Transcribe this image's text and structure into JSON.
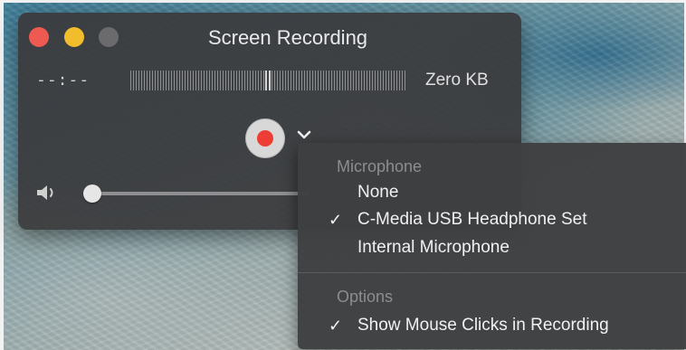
{
  "window": {
    "title": "Screen Recording",
    "time": "--:--",
    "file_size": "Zero KB",
    "input_level_fraction": 0.5,
    "volume_fraction": 0.0,
    "accent_record": "#ee3d34"
  },
  "menu": {
    "microphone_header": "Microphone",
    "microphone_items": [
      {
        "label": "None",
        "checked": false
      },
      {
        "label": "C-Media USB Headphone Set",
        "checked": true
      },
      {
        "label": "Internal Microphone",
        "checked": false
      }
    ],
    "options_header": "Options",
    "options_items": [
      {
        "label": "Show Mouse Clicks in Recording",
        "checked": true
      }
    ],
    "check_glyph": "✓"
  },
  "icons": {
    "close": "close-button",
    "minimize": "minimize-button",
    "zoom": "zoom-button",
    "record": "record-icon",
    "chevron": "chevron-down-icon",
    "volume": "speaker-icon"
  }
}
